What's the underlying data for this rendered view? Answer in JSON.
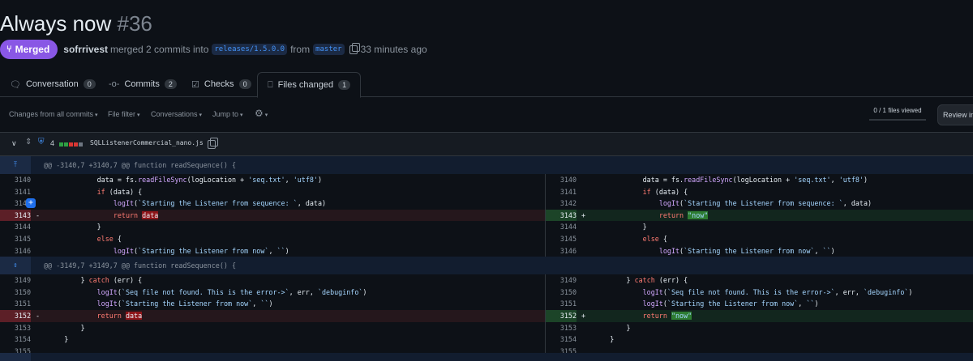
{
  "pr": {
    "title": "Always now",
    "number": "#36",
    "status": "Merged",
    "author": "sofrrivest",
    "merge_text": "merged 2 commits into",
    "base_branch": "releases/1.5.0.0",
    "from_text": "from",
    "head_branch": "master",
    "time": "33 minutes ago"
  },
  "tabs": [
    {
      "label": "Conversation",
      "count": "0",
      "icon": "comment-icon"
    },
    {
      "label": "Commits",
      "count": "2",
      "icon": "commit-icon"
    },
    {
      "label": "Checks",
      "count": "0",
      "icon": "checklist-icon"
    },
    {
      "label": "Files changed",
      "count": "1",
      "icon": "file-diff-icon"
    }
  ],
  "toolbar": {
    "changes": "Changes from all commits",
    "file_filter": "File filter",
    "conversations": "Conversations",
    "jump_to": "Jump to",
    "files_viewed": "0 / 1 files viewed",
    "review_button": "Review in"
  },
  "file": {
    "changes_count": "4",
    "name": "SQLListenerCommercial_nano.js",
    "diffstat_colors": [
      "#2ea043",
      "#2ea043",
      "#da3633",
      "#da3633",
      "#6e7681"
    ]
  },
  "hunks": [
    {
      "header": "@@ -3140,7 +3140,7 @@ function readSequence() {",
      "rows": [
        {
          "ln": "3140",
          "rn": "3140",
          "type": "ctx",
          "indent": 3,
          "text": "data = fs.readFileSync(logLocation + 'seq.txt', 'utf8')"
        },
        {
          "ln": "3141",
          "rn": "3141",
          "type": "ctx",
          "indent": 3,
          "text": "if (data) {"
        },
        {
          "ln": "3142",
          "rn": "3142",
          "type": "ctx",
          "indent": 4,
          "text": "logIt(`Starting the Listener from sequence: `, data)",
          "plus": true
        },
        {
          "ln": "3143",
          "rn": "3143",
          "type": "chg",
          "indent": 4,
          "kw": "return ",
          "old": "data",
          "new": "\"now\""
        },
        {
          "ln": "3144",
          "rn": "3144",
          "type": "ctx",
          "indent": 3,
          "text": "}"
        },
        {
          "ln": "3145",
          "rn": "3145",
          "type": "ctx",
          "indent": 3,
          "text": "else {"
        },
        {
          "ln": "3146",
          "rn": "3146",
          "type": "ctx",
          "indent": 4,
          "text": "logIt(`Starting the Listener from now`, ``)"
        }
      ]
    },
    {
      "header": "@@ -3149,7 +3149,7 @@ function readSequence() {",
      "rows": [
        {
          "ln": "3149",
          "rn": "3149",
          "type": "ctx",
          "indent": 2,
          "text": "} catch (err) {"
        },
        {
          "ln": "3150",
          "rn": "3150",
          "type": "ctx",
          "indent": 3,
          "text": "logIt(`Seq file not found. This is the error->`, err, `debuginfo`)"
        },
        {
          "ln": "3151",
          "rn": "3151",
          "type": "ctx",
          "indent": 3,
          "text": "logIt(`Starting the Listener from now`, ``)"
        },
        {
          "ln": "3152",
          "rn": "3152",
          "type": "chg",
          "indent": 3,
          "kw": "return ",
          "old": "data",
          "new": "\"now\""
        },
        {
          "ln": "3153",
          "rn": "3153",
          "type": "ctx",
          "indent": 2,
          "text": "}"
        },
        {
          "ln": "3154",
          "rn": "3154",
          "type": "ctx",
          "indent": 1,
          "text": "}"
        },
        {
          "ln": "3155",
          "rn": "3155",
          "type": "ctx",
          "indent": 0,
          "text": ""
        }
      ]
    }
  ]
}
